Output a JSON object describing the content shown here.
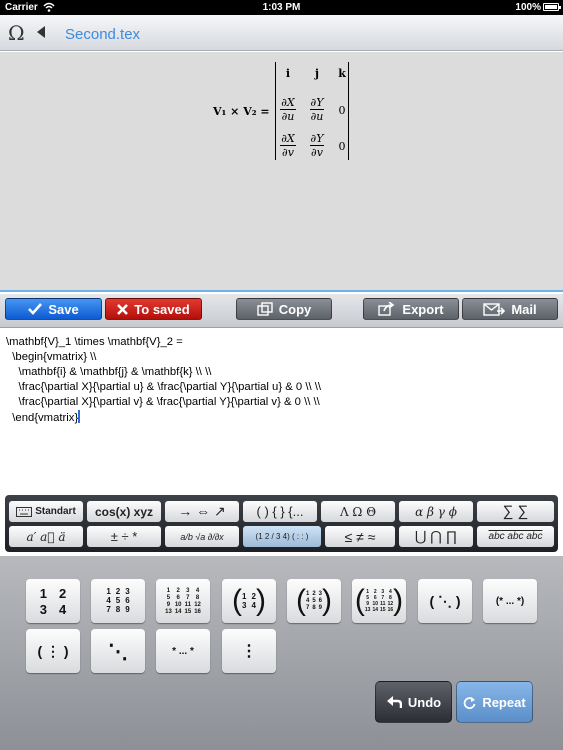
{
  "status": {
    "carrier": "Carrier",
    "time": "1:03 PM",
    "battery": "100%"
  },
  "nav": {
    "title": "Second.tex",
    "menu_icon": "omega-icon",
    "back_icon": "back-arrow-icon"
  },
  "preview": {
    "lhs": "V₁ × V₂ =",
    "row1": [
      "i",
      "j",
      "k"
    ],
    "row2": {
      "n1": "∂X",
      "d1": "∂u",
      "n2": "∂Y",
      "d2": "∂u",
      "c3": "0"
    },
    "row3": {
      "n1": "∂X",
      "d1": "∂v",
      "n2": "∂Y",
      "d2": "∂v",
      "c3": "0"
    }
  },
  "toolbar": {
    "save": "Save",
    "to_saved": "To saved",
    "copy": "Copy",
    "export": "Export",
    "mail": "Mail"
  },
  "editor": {
    "lines": [
      "\\mathbf{V}_1 \\times \\mathbf{V}_2 =",
      "  \\begin{vmatrix} \\\\",
      "    \\mathbf{i} & \\mathbf{j} & \\mathbf{k} \\\\ \\\\",
      "    \\frac{\\partial X}{\\partial u} & \\frac{\\partial Y}{\\partial u} & 0 \\\\ \\\\",
      "    \\frac{\\partial X}{\\partial v} & \\frac{\\partial Y}{\\partial v} & 0 \\\\ \\\\",
      "  \\end{vmatrix}"
    ]
  },
  "keyboard_bar": {
    "row1": [
      "Standart",
      "cos(x)  xyz",
      "→  ⇔  ↗",
      "( )  { }  {...",
      "Λ   Ω   Θ",
      "α  β  γ  ϕ",
      "∑   ∑"
    ],
    "row2": [
      "a′   a⃗   ä",
      "±   ÷   *",
      "a/b  √a  ∂/∂x",
      "(1 2 / 3 4)  ( : : )",
      "≤   ≠   ≈",
      "⋃   ⋂   ∏",
      "abc  abc  abc"
    ]
  },
  "matrix_keys": {
    "k1": [
      "1",
      "2",
      "3",
      "4"
    ],
    "k2": [
      "1",
      "2",
      "3",
      "4",
      "5",
      "6",
      "7",
      "8",
      "9"
    ],
    "k3": [
      "1",
      "2",
      "3",
      "4",
      "5",
      "6",
      "7",
      "8",
      "9",
      "10",
      "11",
      "12",
      "13",
      "14",
      "15",
      "16"
    ],
    "k4": [
      "1",
      "2",
      "3",
      "4"
    ],
    "k5": [
      "1",
      "2",
      "3",
      "4",
      "5",
      "6",
      "7",
      "8",
      "9"
    ],
    "k6": [
      "1",
      "2",
      "3",
      "4",
      "5",
      "6",
      "7",
      "8",
      "9",
      "10",
      "11",
      "12",
      "13",
      "14",
      "15",
      "16"
    ],
    "k7": "( ⋱ )",
    "k8": "(*  ...  *)",
    "k9": "( ⋮ )",
    "k10": "⋱",
    "k11": "*  ...  *",
    "k12": "⋮"
  },
  "actions": {
    "undo": "Undo",
    "repeat": "Repeat"
  }
}
